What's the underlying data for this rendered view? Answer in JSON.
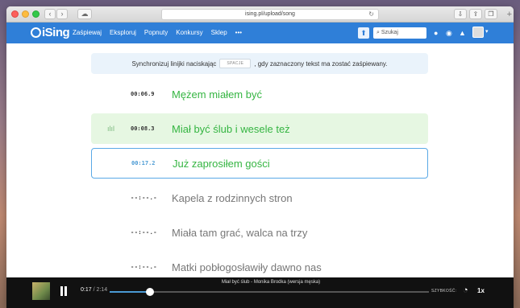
{
  "browser": {
    "url": "ising.pl/upload/song",
    "back_icon": "chevron-left-icon",
    "forward_icon": "chevron-right-icon"
  },
  "header": {
    "logo": "iSing",
    "nav": [
      "Zaśpiewaj",
      "Eksploruj",
      "Popnuty",
      "Konkursy",
      "Sklep",
      "•••"
    ],
    "search_placeholder": "Szukaj"
  },
  "info": {
    "before": "Synchronizuj linijki naciskając",
    "key": "SPACJE",
    "after": ", gdy zaznaczony tekst ma zostać zaśpiewany."
  },
  "lines": [
    {
      "time": "00:06.9",
      "text": "Mężem miałem być",
      "state": "done"
    },
    {
      "time": "00:08.3",
      "text": "Miał być ślub i wesele też",
      "state": "playing"
    },
    {
      "time": "00:17.2",
      "text": "Już zaprosiłem gości",
      "state": "active"
    },
    {
      "time": "--:--.-",
      "text": "Kapela z rodzinnych stron",
      "state": "pending"
    },
    {
      "time": "--:--.-",
      "text": "Miała tam grać, walca na trzy",
      "state": "pending"
    },
    {
      "time": "--:--.-",
      "text": "Matki pobłogosławiły dawno nas",
      "state": "pending"
    }
  ],
  "player": {
    "current": "0:17",
    "total": "/ 2:14",
    "title": "Miał być ślub - Monika Brodka (wersja męska)",
    "progress": 0.127,
    "speed_label": "SZYBKOŚĆ:",
    "speed_value": "1x"
  },
  "colors": {
    "brand": "#2f7fd8",
    "sung_text": "#35b542",
    "active_border": "#5aa9e6"
  }
}
